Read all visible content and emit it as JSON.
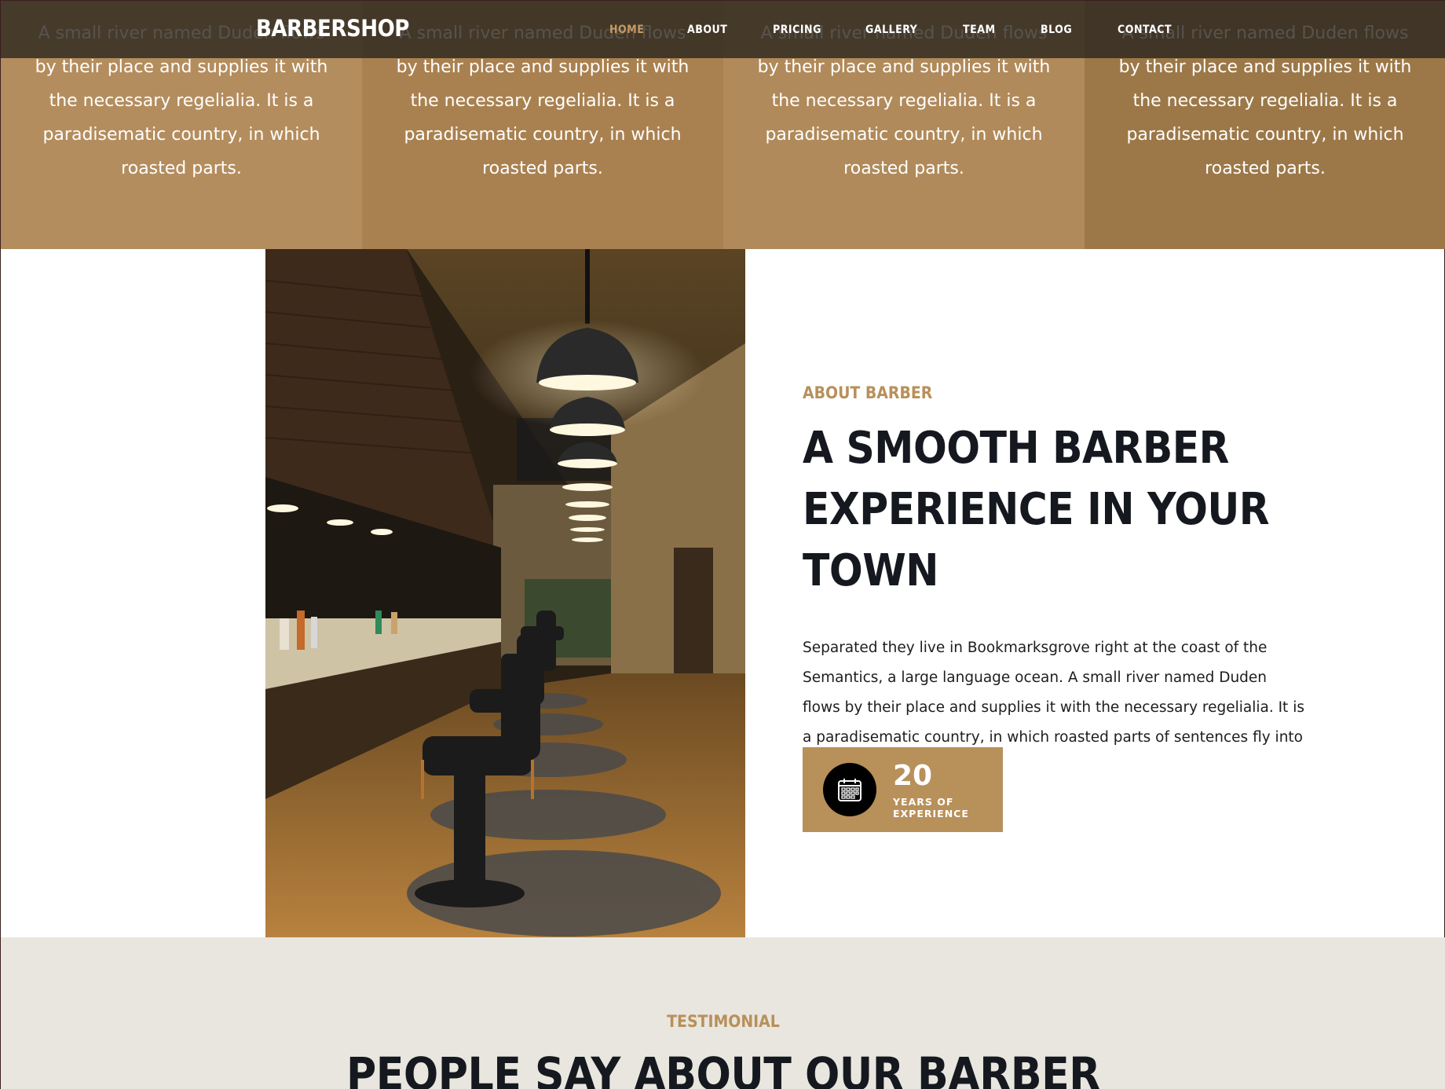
{
  "navbar": {
    "brand": "BARBERSHOP",
    "items": [
      "HOME",
      "ABOUT",
      "PRICING",
      "GALLERY",
      "TEAM",
      "BLOG",
      "CONTACT"
    ],
    "active": "HOME"
  },
  "features": [
    {
      "text": "A small river named Duden flows by their place and supplies it with the necessary regelialia. It is a paradisematic country, in which roasted parts."
    },
    {
      "text": "A small river named Duden flows by their place and supplies it with the necessary regelialia. It is a paradisematic country, in which roasted parts."
    },
    {
      "text": "A small river named Duden flows by their place and supplies it with the necessary regelialia. It is a paradisematic country, in which roasted parts."
    },
    {
      "text": "A small river named Duden flows by their place and supplies it with the necessary regelialia. It is a paradisematic country, in which roasted parts."
    }
  ],
  "about": {
    "eyebrow": "ABOUT BARBER",
    "title_line1": "A SMOOTH BARBER",
    "title_line2": "EXPERIENCE IN YOUR TOWN",
    "body": "Separated they live in Bookmarksgrove right at the coast of the Semantics, a large language ocean. A small river named Duden flows by their place and supplies it with the necessary regelialia. It is a paradisematic country, in which roasted parts of sentences fly into your mouth.",
    "experience_number": "20",
    "experience_label_line1": "YEARS OF",
    "experience_label_line2": "EXPERIENCE",
    "icon": "calendar-icon"
  },
  "testimonial": {
    "eyebrow": "TESTIMONIAL",
    "title": "PEOPLE SAY ABOUT OUR BARBER"
  },
  "colors": {
    "accent": "#b8905a",
    "nav_bg": "#26221c",
    "feature_1": "#b48d5e",
    "feature_2": "#a98150",
    "feature_3": "#b08a5a",
    "feature_4": "#9c7848",
    "testimonial_bg": "#e9e6df"
  }
}
